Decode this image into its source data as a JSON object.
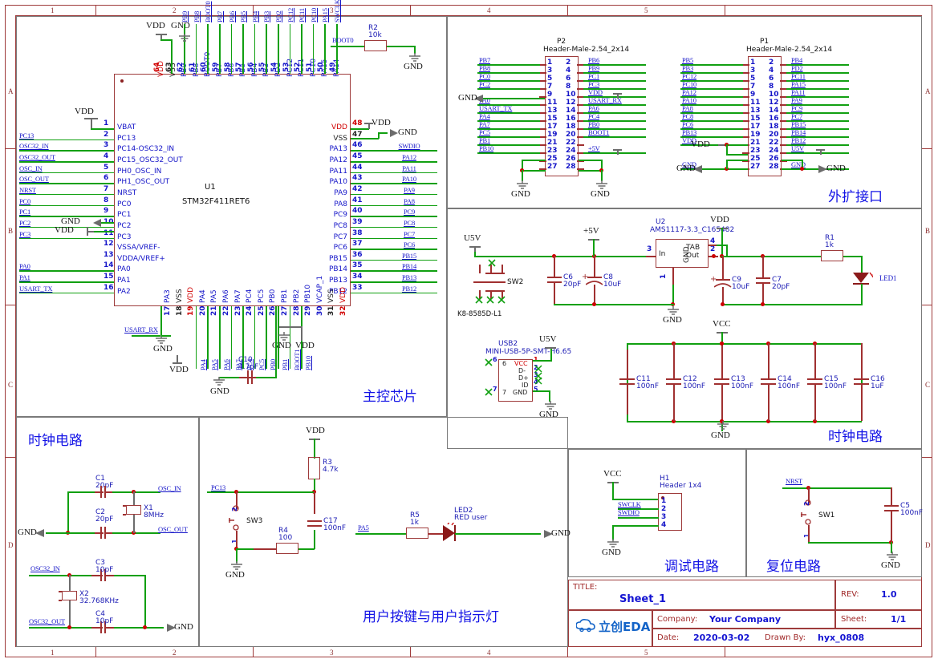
{
  "sheet": {
    "zone_cols": [
      "1",
      "2",
      "3",
      "4",
      "5"
    ],
    "zone_rows": [
      "A",
      "B",
      "C",
      "D"
    ]
  },
  "title_block": {
    "title_key": "TITLE:",
    "title_value": "Sheet_1",
    "rev_key": "REV:",
    "rev_value": "1.0",
    "company_key": "Company:",
    "company_value": "Your Company",
    "sheet_key": "Sheet:",
    "sheet_value": "1/1",
    "date_key": "Date:",
    "date_value": "2020-03-02",
    "drawn_key": "Drawn By:",
    "drawn_value": "hyx_0808",
    "logo_text": "立创EDA"
  },
  "sections": {
    "mcu": "主控芯片",
    "expansion": "外扩接口",
    "power_clock": "时钟电路",
    "clock": "时钟电路",
    "user": "用户按键与用户指示灯",
    "debug": "调试电路",
    "reset": "复位电路"
  },
  "mcu": {
    "refdes": "U1",
    "device": "STM32F411RET6",
    "left_pins": [
      {
        "num": "1",
        "name": "VBAT",
        "net": ""
      },
      {
        "num": "2",
        "name": "PC13",
        "net": "PC13"
      },
      {
        "num": "3",
        "name": "PC14-OSC32_IN",
        "net": "OSC32_IN"
      },
      {
        "num": "4",
        "name": "PC15_OSC32_OUT",
        "net": "OSC32_OUT"
      },
      {
        "num": "5",
        "name": "PH0_OSC_IN",
        "net": "OSC_IN"
      },
      {
        "num": "6",
        "name": "PH1_OSC_OUT",
        "net": "OSC_OUT"
      },
      {
        "num": "7",
        "name": "NRST",
        "net": "NRST"
      },
      {
        "num": "8",
        "name": "PC0",
        "net": "PC0"
      },
      {
        "num": "9",
        "name": "PC1",
        "net": "PC1"
      },
      {
        "num": "10",
        "name": "PC2",
        "net": "PC2"
      },
      {
        "num": "11",
        "name": "PC3",
        "net": "PC3"
      },
      {
        "num": "12",
        "name": "VSSA/VREF-",
        "net": ""
      },
      {
        "num": "13",
        "name": "VDDA/VREF+",
        "net": ""
      },
      {
        "num": "14",
        "name": "PA0",
        "net": "PA0"
      },
      {
        "num": "15",
        "name": "PA1",
        "net": "PA1"
      },
      {
        "num": "16",
        "name": "PA2",
        "net": "USART_TX"
      }
    ],
    "right_pins": [
      {
        "num": "48",
        "name": "VDD",
        "net": ""
      },
      {
        "num": "47",
        "name": "VSS",
        "net": ""
      },
      {
        "num": "46",
        "name": "PA13",
        "net": "SWDIO"
      },
      {
        "num": "45",
        "name": "PA12",
        "net": "PA12"
      },
      {
        "num": "44",
        "name": "PA11",
        "net": "PA11"
      },
      {
        "num": "43",
        "name": "PA10",
        "net": "PA10"
      },
      {
        "num": "42",
        "name": "PA9",
        "net": "PA9"
      },
      {
        "num": "41",
        "name": "PA8",
        "net": "PA8"
      },
      {
        "num": "40",
        "name": "PC9",
        "net": "PC9"
      },
      {
        "num": "39",
        "name": "PC8",
        "net": "PC8"
      },
      {
        "num": "38",
        "name": "PC7",
        "net": "PC7"
      },
      {
        "num": "37",
        "name": "PC6",
        "net": "PC6"
      },
      {
        "num": "36",
        "name": "PB15",
        "net": "PB15"
      },
      {
        "num": "35",
        "name": "PB14",
        "net": "PB14"
      },
      {
        "num": "34",
        "name": "PB13",
        "net": "PB13"
      },
      {
        "num": "33",
        "name": "PB12",
        "net": "PB12"
      }
    ],
    "top_pins": [
      {
        "num": "64",
        "name": "VDD",
        "net": ""
      },
      {
        "num": "63",
        "name": "VSS",
        "net": ""
      },
      {
        "num": "62",
        "name": "PB9",
        "net": "PB9"
      },
      {
        "num": "61",
        "name": "PB8",
        "net": "PB8"
      },
      {
        "num": "60",
        "name": "BOOT0",
        "net": "BOOT0"
      },
      {
        "num": "59",
        "name": "PB7",
        "net": "PB7"
      },
      {
        "num": "58",
        "name": "PB6",
        "net": "PB6"
      },
      {
        "num": "57",
        "name": "PB5",
        "net": "PB5"
      },
      {
        "num": "56",
        "name": "PB4",
        "net": "PB4"
      },
      {
        "num": "55",
        "name": "PB3",
        "net": "PB3"
      },
      {
        "num": "54",
        "name": "PD2",
        "net": "PD2"
      },
      {
        "num": "53",
        "name": "PC12",
        "net": "PC12"
      },
      {
        "num": "52",
        "name": "PC11",
        "net": "PC11"
      },
      {
        "num": "51",
        "name": "PC10",
        "net": "PC10"
      },
      {
        "num": "50",
        "name": "PA15",
        "net": "PA15"
      },
      {
        "num": "49",
        "name": "PA14",
        "net": "SWCLK"
      }
    ],
    "bottom_pins": [
      {
        "num": "17",
        "name": "PA3",
        "net": "USART_RX"
      },
      {
        "num": "18",
        "name": "VSS",
        "net": ""
      },
      {
        "num": "19",
        "name": "VDD",
        "net": ""
      },
      {
        "num": "20",
        "name": "PA4",
        "net": "PA4"
      },
      {
        "num": "21",
        "name": "PA5",
        "net": "PA5"
      },
      {
        "num": "22",
        "name": "PA6",
        "net": "PA6"
      },
      {
        "num": "23",
        "name": "PA7",
        "net": "PA7"
      },
      {
        "num": "24",
        "name": "PC4",
        "net": "PC4"
      },
      {
        "num": "25",
        "name": "PC5",
        "net": "PC5"
      },
      {
        "num": "26",
        "name": "PB0",
        "net": "PB0"
      },
      {
        "num": "27",
        "name": "PB1",
        "net": "PB1"
      },
      {
        "num": "28",
        "name": "PB2",
        "net": "BOOT1"
      },
      {
        "num": "29",
        "name": "PB10",
        "net": "PB10"
      },
      {
        "num": "30",
        "name": "VCAP_1",
        "net": ""
      },
      {
        "num": "31",
        "name": "VSS",
        "net": ""
      },
      {
        "num": "32",
        "name": "VDD",
        "net": ""
      }
    ]
  },
  "r2": {
    "refdes": "R2",
    "value": "10k",
    "net": "BOOT0",
    "gnd": "GND"
  },
  "c10": {
    "refdes": "C10",
    "value": "4.7pF"
  },
  "p2": {
    "refdes": "P2",
    "device": "Header-Male-2.54_2x14",
    "left": [
      {
        "num": "1",
        "net": "PB7"
      },
      {
        "num": "3",
        "net": "PB8"
      },
      {
        "num": "5",
        "net": "PC0"
      },
      {
        "num": "7",
        "net": "PC2"
      },
      {
        "num": "9",
        "net": ""
      },
      {
        "num": "11",
        "net": "PA0"
      },
      {
        "num": "13",
        "net": "USART_TX"
      },
      {
        "num": "15",
        "net": "PA4"
      },
      {
        "num": "17",
        "net": "PA7"
      },
      {
        "num": "19",
        "net": "PC5"
      },
      {
        "num": "21",
        "net": "PB1"
      },
      {
        "num": "23",
        "net": "PB10"
      },
      {
        "num": "25",
        "net": ""
      },
      {
        "num": "27",
        "net": ""
      }
    ],
    "right": [
      {
        "num": "2",
        "net": "PB6"
      },
      {
        "num": "4",
        "net": "PB9"
      },
      {
        "num": "6",
        "net": "PC1"
      },
      {
        "num": "8",
        "net": "PC3"
      },
      {
        "num": "10",
        "net": "VDD"
      },
      {
        "num": "12",
        "net": "USART_RX"
      },
      {
        "num": "14",
        "net": "PA6"
      },
      {
        "num": "16",
        "net": "PC4"
      },
      {
        "num": "18",
        "net": "PB0"
      },
      {
        "num": "20",
        "net": "BOOT1"
      },
      {
        "num": "22",
        "net": ""
      },
      {
        "num": "24",
        "net": "+5V"
      },
      {
        "num": "26",
        "net": ""
      },
      {
        "num": "28",
        "net": ""
      }
    ],
    "gnd_left": "GND",
    "gnd_bot_l": "GND",
    "gnd_bot_r": "GND"
  },
  "p1": {
    "refdes": "P1",
    "device": "Header-Male-2.54_2x14",
    "left": [
      {
        "num": "1",
        "net": "PB5"
      },
      {
        "num": "3",
        "net": "PB3"
      },
      {
        "num": "5",
        "net": "PC12"
      },
      {
        "num": "7",
        "net": "PC10"
      },
      {
        "num": "9",
        "net": "PA12"
      },
      {
        "num": "11",
        "net": "PA10"
      },
      {
        "num": "13",
        "net": "PA8"
      },
      {
        "num": "15",
        "net": "PC8"
      },
      {
        "num": "17",
        "net": "PC6"
      },
      {
        "num": "19",
        "net": "PB13"
      },
      {
        "num": "21",
        "net": "VDD"
      },
      {
        "num": "23",
        "net": ""
      },
      {
        "num": "25",
        "net": ""
      },
      {
        "num": "27",
        "net": "GND"
      }
    ],
    "right": [
      {
        "num": "2",
        "net": "PB4"
      },
      {
        "num": "4",
        "net": "PD2"
      },
      {
        "num": "6",
        "net": "PC11"
      },
      {
        "num": "8",
        "net": "PA15"
      },
      {
        "num": "10",
        "net": "PA11"
      },
      {
        "num": "12",
        "net": "PA9"
      },
      {
        "num": "14",
        "net": "PC9"
      },
      {
        "num": "16",
        "net": "PC7"
      },
      {
        "num": "18",
        "net": "PB15"
      },
      {
        "num": "20",
        "net": "PB14"
      },
      {
        "num": "22",
        "net": "PB12"
      },
      {
        "num": "24",
        "net": "U5V"
      },
      {
        "num": "26",
        "net": ""
      },
      {
        "num": "28",
        "net": "GND"
      }
    ]
  },
  "power": {
    "u5v": "U5V",
    "sw2_ref": "SW2",
    "sw2_dev": "K8-8585D-L1",
    "p5v": "+5V",
    "c6": {
      "refdes": "C6",
      "value": "20pF"
    },
    "c8": {
      "refdes": "C8",
      "value": "10uF"
    },
    "u2_ref": "U2",
    "u2_dev": "AMS1117-3.3_C165482",
    "u2_pins": {
      "in": "In",
      "gnd": "GND",
      "tab": "TAB",
      "out": "Out",
      "n1": "1",
      "n2": "2",
      "n3": "3",
      "n4": "4"
    },
    "gnd": "GND",
    "vdd": "VDD",
    "c9": {
      "refdes": "C9",
      "value": "10uF"
    },
    "c7": {
      "refdes": "C7",
      "value": "20pF"
    },
    "r1": {
      "refdes": "R1",
      "value": "1k"
    },
    "led1": "LED1"
  },
  "usb": {
    "refdes": "USB2",
    "device": "MINI-USB-5P-SMT-H6.65",
    "u5v": "U5V",
    "gnd": "GND",
    "pins": [
      {
        "num": "1",
        "name": "VCC"
      },
      {
        "num": "2",
        "name": "D-"
      },
      {
        "num": "3",
        "name": "D+"
      },
      {
        "num": "4",
        "name": "ID"
      },
      {
        "num": "5",
        "name": "GND"
      },
      {
        "num": "6",
        "name": "6"
      },
      {
        "num": "7",
        "name": "7"
      }
    ],
    "shield": [
      "6",
      "7"
    ]
  },
  "decouple": {
    "vcc": "VCC",
    "gnd_top": "GND",
    "gnd_bot": "GND",
    "caps": [
      {
        "refdes": "C11",
        "value": "100nF"
      },
      {
        "refdes": "C12",
        "value": "100nF"
      },
      {
        "refdes": "C13",
        "value": "100nF"
      },
      {
        "refdes": "C14",
        "value": "100nF"
      },
      {
        "refdes": "C15",
        "value": "100nF"
      },
      {
        "refdes": "C16",
        "value": "1uF"
      }
    ]
  },
  "clock": {
    "gnd": "GND",
    "gnd2": "GND",
    "c1": {
      "refdes": "C1",
      "value": "20pF"
    },
    "c2": {
      "refdes": "C2",
      "value": "20pF"
    },
    "x1": {
      "refdes": "X1",
      "value": "8MHz"
    },
    "osc_in": "OSC_IN",
    "osc_out": "OSC_OUT",
    "c3": {
      "refdes": "C3",
      "value": "10pF"
    },
    "c4": {
      "refdes": "C4",
      "value": "10pF"
    },
    "x2": {
      "refdes": "X2",
      "value": "32.768KHz"
    },
    "osc32_in": "OSC32_IN",
    "osc32_out": "OSC32_OUT"
  },
  "user": {
    "vdd": "VDD",
    "gnd": "GND",
    "r3": {
      "refdes": "R3",
      "value": "4.7k"
    },
    "r4": {
      "refdes": "R4",
      "value": "100"
    },
    "c17": {
      "refdes": "C17",
      "value": "100nF"
    },
    "sw3": {
      "refdes": "SW3",
      "p1": "1",
      "p2": "2"
    },
    "pc13": "PC13",
    "pa5": "PA5",
    "r5": {
      "refdes": "R5",
      "value": "1k"
    },
    "led2": {
      "refdes": "LED2",
      "desc": "RED user"
    },
    "gnd_right": "GND"
  },
  "debug": {
    "vcc": "VCC",
    "gnd": "GND",
    "h1_ref": "H1",
    "h1_dev": "Header 1x4",
    "pins": [
      {
        "num": "1",
        "net": ""
      },
      {
        "num": "2",
        "net": "SWCLK"
      },
      {
        "num": "3",
        "net": "SWDIO"
      },
      {
        "num": "4",
        "net": ""
      }
    ]
  },
  "reset": {
    "nrst": "NRST",
    "sw1": {
      "refdes": "SW1",
      "p1": "1",
      "p2": "2"
    },
    "c5": {
      "refdes": "C5",
      "value": "100nF"
    },
    "gnd": "GND"
  }
}
